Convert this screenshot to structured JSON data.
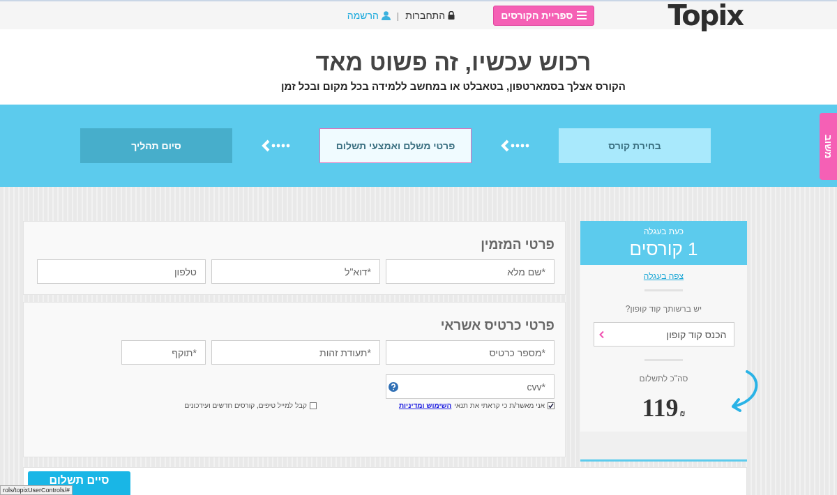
{
  "top_bar": {
    "logo": "Topix",
    "library_button": "ספריית הקורסים",
    "login": "התחברות",
    "separator": "|",
    "register": "הרשמה"
  },
  "header": {
    "title": "רכוש עכשיו, זה פשוט מאד",
    "subtitle": "הקורס אצלך בסמארטפון, בטאבלט או במחשב ללמידה בכל מקום ובכל זמן"
  },
  "steps": [
    {
      "label": "בחירת קורס",
      "done": true,
      "selected": false
    },
    {
      "label": "פרטי משלם ואמצעי תשלום",
      "done": false,
      "selected": true
    },
    {
      "label": "סיום תהליך",
      "done": false,
      "selected": false
    }
  ],
  "feedback_tab": "משוב",
  "cart": {
    "caption": "כעת בעגלה",
    "count": "1 קורסים",
    "view_link": "צפה בעגלה",
    "coupon_question": "יש ברשותך קוד קופון?",
    "coupon_placeholder": "הכנס קוד קופון",
    "total_label": "סה\"כ לתשלום",
    "price": "119",
    "currency": "₪"
  },
  "sections": [
    {
      "title": "פרטי המזמין",
      "fields": [
        {
          "placeholder": "*שם מלא",
          "kind": "wide"
        },
        {
          "placeholder": "*דוא\"ל",
          "kind": "wide"
        },
        {
          "placeholder": "טלפון",
          "kind": "wide"
        }
      ]
    },
    {
      "title": "פרטי כרטיס אשראי",
      "fields": [
        {
          "placeholder": "*מספר כרטיס",
          "kind": "wide"
        },
        {
          "placeholder": "*תעודת זהות",
          "kind": "wide"
        },
        {
          "placeholder": "*תוקף",
          "kind": "narrow"
        }
      ],
      "cvv": {
        "placeholder": "*cvv"
      }
    }
  ],
  "agreements": [
    {
      "text": "אני מאשר/ת כי קראתי את תנאי",
      "link": "השימוש ומדיניות",
      "checked": true
    },
    {
      "text": "קבל למייל טיפים, קורסים חדשים ועידכונים",
      "checked": false
    }
  ],
  "submit_button": "סיים תשלום",
  "status_url": "rols/topixUserControls/#"
}
